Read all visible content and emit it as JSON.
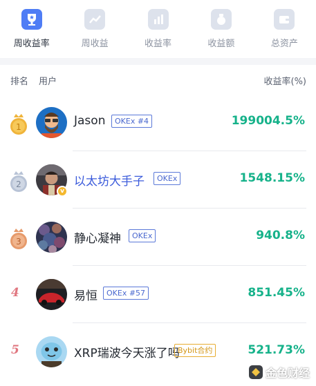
{
  "tabs": [
    {
      "label": "周收益率",
      "icon": "trophy-icon",
      "active": true
    },
    {
      "label": "周收益",
      "icon": "trend-chart-icon",
      "active": false
    },
    {
      "label": "收益率",
      "icon": "bar-chart-icon",
      "active": false
    },
    {
      "label": "收益额",
      "icon": "money-bag-icon",
      "active": false
    },
    {
      "label": "总资产",
      "icon": "wallet-icon",
      "active": false
    }
  ],
  "table": {
    "col_rank": "排名",
    "col_user": "用户",
    "col_rate": "收益率(%)"
  },
  "rows": [
    {
      "rank": "1",
      "medal": "gold",
      "name": "Jason",
      "tag": "OKEx #4",
      "rate": "199004.5%"
    },
    {
      "rank": "2",
      "medal": "silver",
      "name": "以太坊大手子",
      "tag": "OKEx",
      "rate": "1548.15%",
      "verified": true
    },
    {
      "rank": "3",
      "medal": "bronze",
      "name": "静心凝神",
      "tag": "OKEx",
      "rate": "940.8%"
    },
    {
      "rank": "4",
      "name": "易恒",
      "tag": "OKEx #57",
      "rate": "851.45%"
    },
    {
      "rank": "5",
      "name": "XRP瑞波今天涨了吗",
      "tag": "Bybit合约",
      "rate": "521.73%"
    }
  ],
  "watermark": {
    "text": "金色财经"
  },
  "colors": {
    "accent": "#4f7df5",
    "rate_green": "#16b28a",
    "rank_red": "#e0767f",
    "tag_blue": "#4a68cf",
    "tag_gold": "#d49717"
  }
}
